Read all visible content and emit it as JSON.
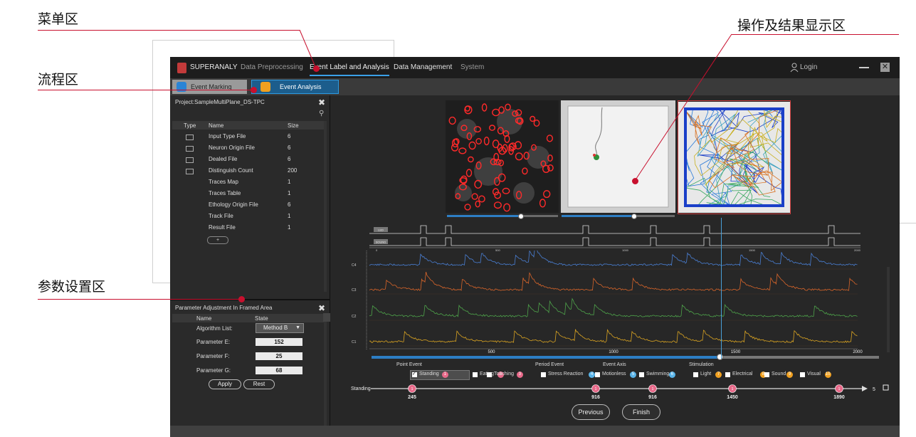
{
  "annotations": {
    "menu_area": "菜单区",
    "process_area": "流程区",
    "param_area": "参数设置区",
    "result_area": "操作及结果显示区"
  },
  "colors": {
    "annotation_line": "#c8102e",
    "accent_blue": "#3aa0e8",
    "panel_bg": "#272727",
    "trace_c1": "#4a7fd4",
    "trace_c2": "#d8652a",
    "trace_c3": "#4ea34a",
    "trace_c4": "#d9a322",
    "marker_pink": "#e86a8a"
  },
  "menubar": {
    "app_name": "SUPERANALY",
    "items": [
      "Data Preprocessing",
      "Event Label and Analysis",
      "Data Management",
      "System"
    ],
    "active_item": "Event Label and Analysis",
    "login": "Login",
    "close": "✕"
  },
  "tabs": {
    "tab1": "Event Marking",
    "tab2": "Event Analysis"
  },
  "project_panel": {
    "title": "Project:SampleMultiPlane_DS-TPC",
    "columns": [
      "Type",
      "Name",
      "Size"
    ],
    "rows": [
      {
        "name": "Input Type File",
        "size": "6",
        "has_icon": true
      },
      {
        "name": "Neuron Origin File",
        "size": "6",
        "has_icon": true
      },
      {
        "name": "Dealed File",
        "size": "6",
        "has_icon": true
      },
      {
        "name": "Distinguish Count",
        "size": "200",
        "has_icon": true
      },
      {
        "name": "Traces Map",
        "size": "1",
        "has_icon": false
      },
      {
        "name": "Traces Table",
        "size": "1",
        "has_icon": false
      },
      {
        "name": "Ethology Origin File",
        "size": "6",
        "has_icon": false
      },
      {
        "name": "Track File",
        "size": "1",
        "has_icon": false
      },
      {
        "name": "Result File",
        "size": "1",
        "has_icon": false
      }
    ],
    "add_button": "+"
  },
  "param_panel": {
    "title": "Parameter Adjustment In Framed Area",
    "columns": [
      "Name",
      "State"
    ],
    "algorithm_label": "Algorithm List:",
    "algorithm_value": "Method B",
    "params": [
      {
        "label": "Parameter E:",
        "value": "152"
      },
      {
        "label": "Parameter F:",
        "value": "25"
      },
      {
        "label": "Parameter G:",
        "value": "68"
      }
    ],
    "apply_button": "Apply",
    "reset_button": "Rest"
  },
  "stim_chart": {
    "rows": [
      "LED",
      "SOUND"
    ],
    "ticks": [
      "0",
      "500",
      "1000",
      "1500",
      "2000"
    ]
  },
  "chart_data": {
    "type": "line",
    "series": [
      {
        "name": "C4",
        "color": "#4a7fd4"
      },
      {
        "name": "C3",
        "color": "#d8652a"
      },
      {
        "name": "C2",
        "color": "#4ea34a"
      },
      {
        "name": "C1",
        "color": "#d9a322"
      }
    ],
    "x_ticks": [
      500,
      1000,
      1500,
      2000
    ],
    "xlim": [
      0,
      2000
    ],
    "cursor_x": 1500
  },
  "event_axis_labels": [
    "Point Event",
    "Period Event",
    "Event Axis",
    "Stimulation"
  ],
  "events": {
    "point": [
      {
        "label": "Standing",
        "count": "1",
        "color": "#e86a8a",
        "checked": true
      },
      {
        "label": "Eating",
        "count": "2",
        "color": "#e86a8a",
        "checked": false
      },
      {
        "label": "Touching",
        "count": "3",
        "color": "#e86a8a",
        "checked": false
      }
    ],
    "period": [
      {
        "label": "Stress Reaction",
        "count": "4",
        "color": "#5ab4e8",
        "checked": false
      },
      {
        "label": "Motionless",
        "count": "5",
        "color": "#5ab4e8",
        "checked": false
      },
      {
        "label": "Swimming",
        "count": "6",
        "color": "#5ab4e8",
        "checked": false
      }
    ],
    "stimulation": [
      {
        "label": "Light",
        "count": "7",
        "color": "#f0a020",
        "checked": false
      },
      {
        "label": "Electrical",
        "count": "8",
        "color": "#f0a020",
        "checked": false
      },
      {
        "label": "Sound",
        "count": "9",
        "color": "#f0a020",
        "checked": false
      },
      {
        "label": "Visual",
        "count": "10",
        "color": "#f0a020",
        "checked": false
      }
    ]
  },
  "timeline": {
    "label": "Standing",
    "total_count": "5",
    "marker_values": [
      245,
      916,
      916,
      1450,
      1890
    ]
  },
  "nav": {
    "previous": "Previous",
    "finish": "Finish"
  }
}
